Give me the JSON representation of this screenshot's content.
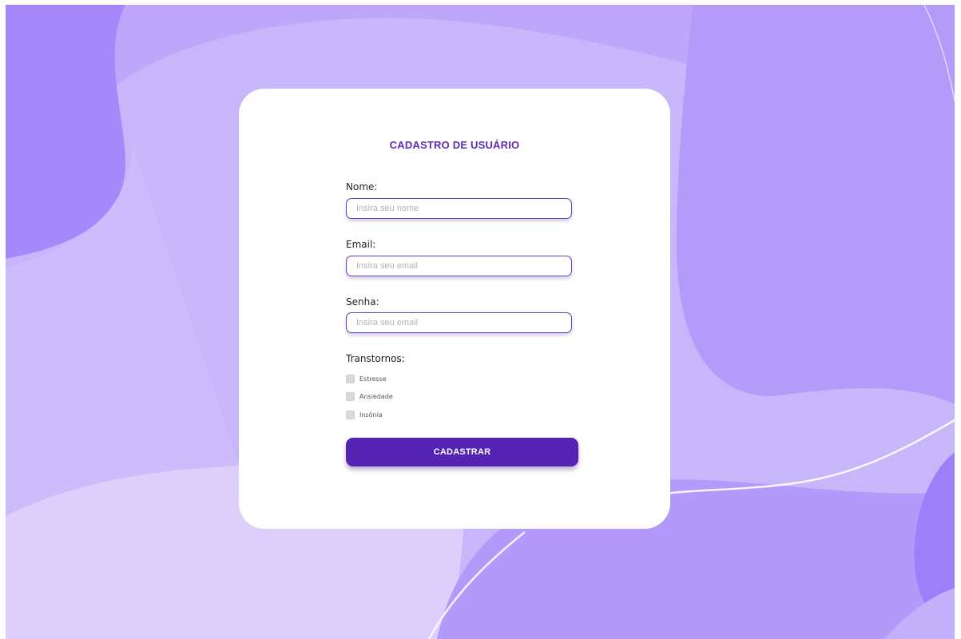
{
  "colors": {
    "accent": "#5523b4",
    "title": "#5b2bb5",
    "input_border": "#6a3cc9",
    "background": "#c8b6fb",
    "background_dark": "#a98bfa",
    "background_light": "#dccffc"
  },
  "form": {
    "title": "CADASTRO DE USUÁRIO",
    "name": {
      "label": "Nome:",
      "placeholder": "Insira seu nome",
      "value": ""
    },
    "email": {
      "label": "Email:",
      "placeholder": "Insira seu email",
      "value": ""
    },
    "password": {
      "label": "Senha:",
      "placeholder": "Insira seu email",
      "value": ""
    },
    "disorders": {
      "label": "Transtornos:",
      "options": [
        {
          "label": "Estresse",
          "checked": false
        },
        {
          "label": "Ansiedade",
          "checked": false
        },
        {
          "label": "Insônia",
          "checked": false
        }
      ]
    },
    "submit_label": "CADASTRAR"
  }
}
